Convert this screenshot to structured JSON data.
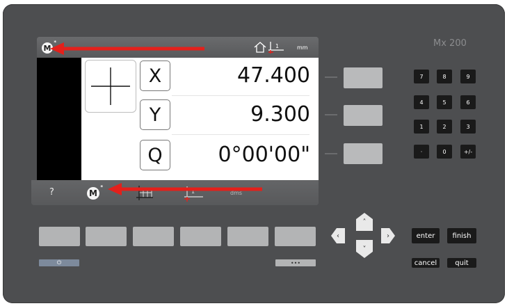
{
  "panel": {
    "model": "Mx 200"
  },
  "screen": {
    "topbar": {
      "mode_badge": "M",
      "mode_badge_sup": "*",
      "unit": "mm"
    },
    "axes": [
      {
        "label": "X",
        "value": "47.400"
      },
      {
        "label": "Y",
        "value": "9.300"
      },
      {
        "label": "Q",
        "value": "0°00'00\""
      }
    ],
    "bottombar": {
      "help": "?",
      "mode_badge": "M",
      "mode_badge_sup": "*",
      "angle_unit": "dms"
    }
  },
  "keypad": [
    "7",
    "8",
    "9",
    "4",
    "5",
    "6",
    "1",
    "2",
    "3",
    "·",
    "0",
    "+/-"
  ],
  "buttons": {
    "enter": "enter",
    "finish": "finish",
    "cancel": "cancel",
    "quit": "quit",
    "more": "•••",
    "power": "⏻"
  },
  "nav": {
    "up": "˄",
    "down": "˅",
    "left": "‹",
    "right": "›"
  },
  "annotation_color": "#e3201b"
}
